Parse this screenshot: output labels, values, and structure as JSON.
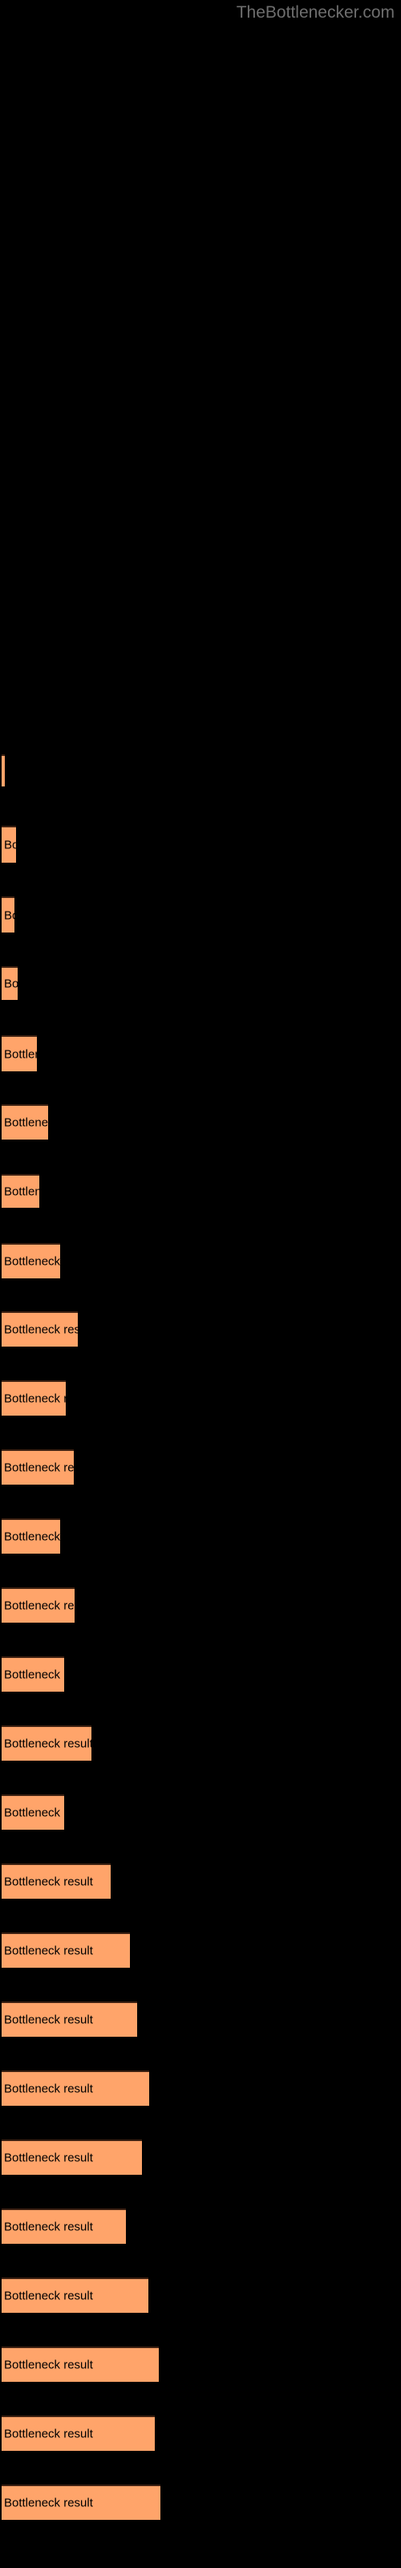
{
  "site": {
    "watermark": "TheBottlenecker.com"
  },
  "colors": {
    "background": "#000000",
    "bar_fill": "#ffa46a",
    "bar_edge": "#3d2112",
    "bar_label_text": "#000000",
    "watermark_text": "#6e6e6e"
  },
  "chart_data": {
    "type": "bar",
    "orientation": "horizontal",
    "title": "",
    "subtitle": "",
    "xlabel": "",
    "ylabel": "",
    "grid": false,
    "legend": null,
    "bar_label_text": "Bottleneck result",
    "axis_visible": false,
    "tick_labels_visible": false,
    "xlim": [
      0,
      500
    ],
    "categories": [
      "Bottleneck result",
      "Bottleneck result",
      "Bottleneck result",
      "Bottleneck result",
      "Bottleneck result",
      "Bottleneck result",
      "Bottleneck result",
      "Bottleneck result",
      "Bottleneck result",
      "Bottleneck result",
      "Bottleneck result",
      "Bottleneck result",
      "Bottleneck result",
      "Bottleneck result",
      "Bottleneck result",
      "Bottleneck result",
      "Bottleneck result",
      "Bottleneck result",
      "Bottleneck result",
      "Bottleneck result",
      "Bottleneck result",
      "Bottleneck result",
      "Bottleneck result",
      "Bottleneck result",
      "Bottleneck result",
      "Bottleneck result"
    ],
    "values": [
      4,
      18,
      16,
      20,
      44,
      58,
      47,
      73,
      95,
      80,
      90,
      73,
      91,
      78,
      112,
      78,
      136,
      160,
      169,
      184,
      175,
      155,
      183,
      196,
      191,
      198
    ],
    "bars": [
      {
        "label": "Bottleneck result",
        "value": 4,
        "top": 940,
        "height": 40,
        "width": 4
      },
      {
        "label": "Bottleneck result",
        "value": 18,
        "top": 1029,
        "height": 46,
        "width": 18
      },
      {
        "label": "Bottleneck result",
        "value": 16,
        "top": 1117,
        "height": 45,
        "width": 16
      },
      {
        "label": "Bottleneck result",
        "value": 20,
        "top": 1204,
        "height": 42,
        "width": 20
      },
      {
        "label": "Bottleneck result",
        "value": 44,
        "top": 1290,
        "height": 45,
        "width": 44
      },
      {
        "label": "Bottleneck result",
        "value": 58,
        "top": 1376,
        "height": 44,
        "width": 58
      },
      {
        "label": "Bottleneck result",
        "value": 47,
        "top": 1463,
        "height": 42,
        "width": 47
      },
      {
        "label": "Bottleneck result",
        "value": 73,
        "top": 1549,
        "height": 44,
        "width": 73
      },
      {
        "label": "Bottleneck result",
        "value": 95,
        "top": 1634,
        "height": 44,
        "width": 95
      },
      {
        "label": "Bottleneck result",
        "value": 80,
        "top": 1720,
        "height": 44,
        "width": 80
      },
      {
        "label": "Bottleneck result",
        "value": 90,
        "top": 1806,
        "height": 44,
        "width": 90
      },
      {
        "label": "Bottleneck result",
        "value": 73,
        "top": 1892,
        "height": 44,
        "width": 73
      },
      {
        "label": "Bottleneck result",
        "value": 91,
        "top": 1978,
        "height": 44,
        "width": 91
      },
      {
        "label": "Bottleneck result",
        "value": 78,
        "top": 2064,
        "height": 44,
        "width": 78
      },
      {
        "label": "Bottleneck result",
        "value": 112,
        "top": 2150,
        "height": 44,
        "width": 112
      },
      {
        "label": "Bottleneck result",
        "value": 78,
        "top": 2236,
        "height": 44,
        "width": 78
      },
      {
        "label": "Bottleneck result",
        "value": 136,
        "top": 2322,
        "height": 44,
        "width": 136
      },
      {
        "label": "Bottleneck result",
        "value": 160,
        "top": 2408,
        "height": 44,
        "width": 160
      },
      {
        "label": "Bottleneck result",
        "value": 169,
        "top": 2494,
        "height": 44,
        "width": 169
      },
      {
        "label": "Bottleneck result",
        "value": 184,
        "top": 2580,
        "height": 44,
        "width": 184
      },
      {
        "label": "Bottleneck result",
        "value": 175,
        "top": 2666,
        "height": 44,
        "width": 175
      },
      {
        "label": "Bottleneck result",
        "value": 155,
        "top": 2752,
        "height": 44,
        "width": 155
      },
      {
        "label": "Bottleneck result",
        "value": 183,
        "top": 2838,
        "height": 44,
        "width": 183
      },
      {
        "label": "Bottleneck result",
        "value": 196,
        "top": 2924,
        "height": 44,
        "width": 196
      },
      {
        "label": "Bottleneck result",
        "value": 191,
        "top": 3010,
        "height": 44,
        "width": 191
      },
      {
        "label": "Bottleneck result",
        "value": 198,
        "top": 3096,
        "height": 44,
        "width": 198
      }
    ]
  }
}
